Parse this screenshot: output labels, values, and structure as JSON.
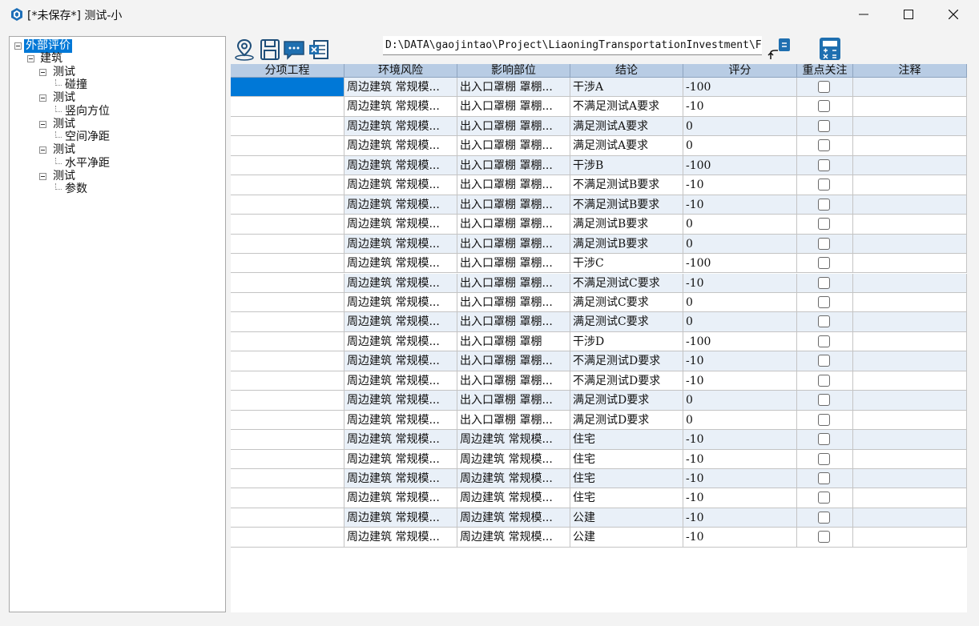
{
  "window": {
    "title": "[*未保存*] 测试-小",
    "colors": {
      "accent": "#0078d7",
      "header": "#b8cce4",
      "row_alt": "#e9f0f8"
    }
  },
  "tree": {
    "nodes": [
      {
        "label": "外部评价",
        "level": 0,
        "expanded": true,
        "selected": true
      },
      {
        "label": "建筑",
        "level": 1,
        "expanded": true
      },
      {
        "label": "测试",
        "level": 2,
        "expanded": true
      },
      {
        "label": "碰撞",
        "level": 3
      },
      {
        "label": "测试",
        "level": 2,
        "expanded": true
      },
      {
        "label": "竖向方位",
        "level": 3
      },
      {
        "label": "测试",
        "level": 2,
        "expanded": true
      },
      {
        "label": "空间净距",
        "level": 3
      },
      {
        "label": "测试",
        "level": 2,
        "expanded": true
      },
      {
        "label": "水平净距",
        "level": 3
      },
      {
        "label": "测试",
        "level": 2,
        "expanded": true
      },
      {
        "label": "参数",
        "level": 3
      }
    ]
  },
  "toolbar": {
    "icons": [
      "location-pin-icon",
      "save-icon",
      "comment-icon",
      "excel-export-icon"
    ],
    "path": "D:\\DATA\\gaojintao\\Project\\LiaoningTransportationInvestment\\Feedback",
    "right_icons": [
      "insert-calc-icon",
      "calculator-icon"
    ]
  },
  "grid": {
    "columns": [
      "分项工程",
      "环境风险",
      "影响部位",
      "结论",
      "评分",
      "重点关注",
      "注释"
    ],
    "rows": [
      {
        "project": "",
        "risk": "周边建筑 常规模...",
        "part": "出入口罩棚 罩棚...",
        "conclusion": "干涉A",
        "score": "-100",
        "focus": false,
        "note": ""
      },
      {
        "project": "",
        "risk": "周边建筑 常规模...",
        "part": "出入口罩棚 罩棚...",
        "conclusion": "不满足测试A要求",
        "score": "-10",
        "focus": false,
        "note": ""
      },
      {
        "project": "",
        "risk": "周边建筑 常规模...",
        "part": "出入口罩棚 罩棚...",
        "conclusion": "满足测试A要求",
        "score": "0",
        "focus": false,
        "note": ""
      },
      {
        "project": "",
        "risk": "周边建筑 常规模...",
        "part": "出入口罩棚 罩棚...",
        "conclusion": "满足测试A要求",
        "score": "0",
        "focus": false,
        "note": ""
      },
      {
        "project": "",
        "risk": "周边建筑 常规模...",
        "part": "出入口罩棚 罩棚...",
        "conclusion": "干涉B",
        "score": "-100",
        "focus": false,
        "note": ""
      },
      {
        "project": "",
        "risk": "周边建筑 常规模...",
        "part": "出入口罩棚 罩棚...",
        "conclusion": "不满足测试B要求",
        "score": "-10",
        "focus": false,
        "note": ""
      },
      {
        "project": "",
        "risk": "周边建筑 常规模...",
        "part": "出入口罩棚 罩棚...",
        "conclusion": "不满足测试B要求",
        "score": "-10",
        "focus": false,
        "note": ""
      },
      {
        "project": "",
        "risk": "周边建筑 常规模...",
        "part": "出入口罩棚 罩棚...",
        "conclusion": "满足测试B要求",
        "score": "0",
        "focus": false,
        "note": ""
      },
      {
        "project": "",
        "risk": "周边建筑 常规模...",
        "part": "出入口罩棚 罩棚...",
        "conclusion": "满足测试B要求",
        "score": "0",
        "focus": false,
        "note": ""
      },
      {
        "project": "",
        "risk": "周边建筑 常规模...",
        "part": "出入口罩棚 罩棚...",
        "conclusion": "干涉C",
        "score": "-100",
        "focus": false,
        "note": ""
      },
      {
        "project": "",
        "risk": "周边建筑 常规模...",
        "part": "出入口罩棚 罩棚...",
        "conclusion": "不满足测试C要求",
        "score": "-10",
        "focus": false,
        "note": ""
      },
      {
        "project": "",
        "risk": "周边建筑 常规模...",
        "part": "出入口罩棚 罩棚...",
        "conclusion": "满足测试C要求",
        "score": "0",
        "focus": false,
        "note": ""
      },
      {
        "project": "",
        "risk": "周边建筑 常规模...",
        "part": "出入口罩棚 罩棚...",
        "conclusion": "满足测试C要求",
        "score": "0",
        "focus": false,
        "note": ""
      },
      {
        "project": "",
        "risk": "周边建筑 常规模...",
        "part": "出入口罩棚 罩棚",
        "conclusion": "干涉D",
        "score": "-100",
        "focus": false,
        "note": ""
      },
      {
        "project": "",
        "risk": "周边建筑 常规模...",
        "part": "出入口罩棚 罩棚...",
        "conclusion": "不满足测试D要求",
        "score": "-10",
        "focus": false,
        "note": ""
      },
      {
        "project": "",
        "risk": "周边建筑 常规模...",
        "part": "出入口罩棚 罩棚...",
        "conclusion": "不满足测试D要求",
        "score": "-10",
        "focus": false,
        "note": ""
      },
      {
        "project": "",
        "risk": "周边建筑 常规模...",
        "part": "出入口罩棚 罩棚...",
        "conclusion": "满足测试D要求",
        "score": "0",
        "focus": false,
        "note": ""
      },
      {
        "project": "",
        "risk": "周边建筑 常规模...",
        "part": "出入口罩棚 罩棚...",
        "conclusion": "满足测试D要求",
        "score": "0",
        "focus": false,
        "note": ""
      },
      {
        "project": "",
        "risk": "周边建筑 常规模...",
        "part": "周边建筑 常规模...",
        "conclusion": "住宅",
        "score": "-10",
        "focus": false,
        "note": ""
      },
      {
        "project": "",
        "risk": "周边建筑 常规模...",
        "part": "周边建筑 常规模...",
        "conclusion": "住宅",
        "score": "-10",
        "focus": false,
        "note": ""
      },
      {
        "project": "",
        "risk": "周边建筑 常规模...",
        "part": "周边建筑 常规模...",
        "conclusion": "住宅",
        "score": "-10",
        "focus": false,
        "note": ""
      },
      {
        "project": "",
        "risk": "周边建筑 常规模...",
        "part": "周边建筑 常规模...",
        "conclusion": "住宅",
        "score": "-10",
        "focus": false,
        "note": ""
      },
      {
        "project": "",
        "risk": "周边建筑 常规模...",
        "part": "周边建筑 常规模...",
        "conclusion": "公建",
        "score": "-10",
        "focus": false,
        "note": ""
      },
      {
        "project": "",
        "risk": "周边建筑 常规模...",
        "part": "周边建筑 常规模...",
        "conclusion": "公建",
        "score": "-10",
        "focus": false,
        "note": ""
      }
    ]
  }
}
